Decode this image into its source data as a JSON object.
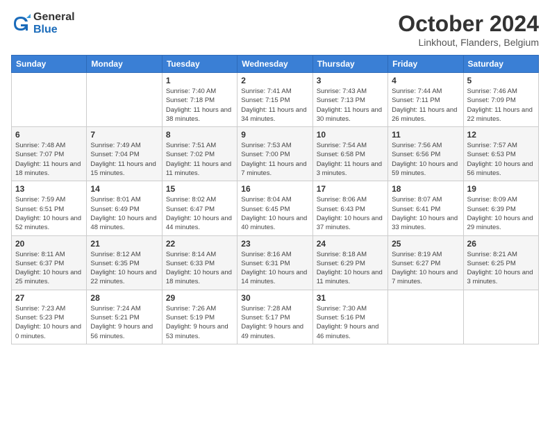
{
  "header": {
    "logo_line1": "General",
    "logo_line2": "Blue",
    "month": "October 2024",
    "location": "Linkhout, Flanders, Belgium"
  },
  "weekdays": [
    "Sunday",
    "Monday",
    "Tuesday",
    "Wednesday",
    "Thursday",
    "Friday",
    "Saturday"
  ],
  "weeks": [
    [
      {
        "day": "",
        "sunrise": "",
        "sunset": "",
        "daylight": ""
      },
      {
        "day": "",
        "sunrise": "",
        "sunset": "",
        "daylight": ""
      },
      {
        "day": "1",
        "sunrise": "Sunrise: 7:40 AM",
        "sunset": "Sunset: 7:18 PM",
        "daylight": "Daylight: 11 hours and 38 minutes."
      },
      {
        "day": "2",
        "sunrise": "Sunrise: 7:41 AM",
        "sunset": "Sunset: 7:15 PM",
        "daylight": "Daylight: 11 hours and 34 minutes."
      },
      {
        "day": "3",
        "sunrise": "Sunrise: 7:43 AM",
        "sunset": "Sunset: 7:13 PM",
        "daylight": "Daylight: 11 hours and 30 minutes."
      },
      {
        "day": "4",
        "sunrise": "Sunrise: 7:44 AM",
        "sunset": "Sunset: 7:11 PM",
        "daylight": "Daylight: 11 hours and 26 minutes."
      },
      {
        "day": "5",
        "sunrise": "Sunrise: 7:46 AM",
        "sunset": "Sunset: 7:09 PM",
        "daylight": "Daylight: 11 hours and 22 minutes."
      }
    ],
    [
      {
        "day": "6",
        "sunrise": "Sunrise: 7:48 AM",
        "sunset": "Sunset: 7:07 PM",
        "daylight": "Daylight: 11 hours and 18 minutes."
      },
      {
        "day": "7",
        "sunrise": "Sunrise: 7:49 AM",
        "sunset": "Sunset: 7:04 PM",
        "daylight": "Daylight: 11 hours and 15 minutes."
      },
      {
        "day": "8",
        "sunrise": "Sunrise: 7:51 AM",
        "sunset": "Sunset: 7:02 PM",
        "daylight": "Daylight: 11 hours and 11 minutes."
      },
      {
        "day": "9",
        "sunrise": "Sunrise: 7:53 AM",
        "sunset": "Sunset: 7:00 PM",
        "daylight": "Daylight: 11 hours and 7 minutes."
      },
      {
        "day": "10",
        "sunrise": "Sunrise: 7:54 AM",
        "sunset": "Sunset: 6:58 PM",
        "daylight": "Daylight: 11 hours and 3 minutes."
      },
      {
        "day": "11",
        "sunrise": "Sunrise: 7:56 AM",
        "sunset": "Sunset: 6:56 PM",
        "daylight": "Daylight: 10 hours and 59 minutes."
      },
      {
        "day": "12",
        "sunrise": "Sunrise: 7:57 AM",
        "sunset": "Sunset: 6:53 PM",
        "daylight": "Daylight: 10 hours and 56 minutes."
      }
    ],
    [
      {
        "day": "13",
        "sunrise": "Sunrise: 7:59 AM",
        "sunset": "Sunset: 6:51 PM",
        "daylight": "Daylight: 10 hours and 52 minutes."
      },
      {
        "day": "14",
        "sunrise": "Sunrise: 8:01 AM",
        "sunset": "Sunset: 6:49 PM",
        "daylight": "Daylight: 10 hours and 48 minutes."
      },
      {
        "day": "15",
        "sunrise": "Sunrise: 8:02 AM",
        "sunset": "Sunset: 6:47 PM",
        "daylight": "Daylight: 10 hours and 44 minutes."
      },
      {
        "day": "16",
        "sunrise": "Sunrise: 8:04 AM",
        "sunset": "Sunset: 6:45 PM",
        "daylight": "Daylight: 10 hours and 40 minutes."
      },
      {
        "day": "17",
        "sunrise": "Sunrise: 8:06 AM",
        "sunset": "Sunset: 6:43 PM",
        "daylight": "Daylight: 10 hours and 37 minutes."
      },
      {
        "day": "18",
        "sunrise": "Sunrise: 8:07 AM",
        "sunset": "Sunset: 6:41 PM",
        "daylight": "Daylight: 10 hours and 33 minutes."
      },
      {
        "day": "19",
        "sunrise": "Sunrise: 8:09 AM",
        "sunset": "Sunset: 6:39 PM",
        "daylight": "Daylight: 10 hours and 29 minutes."
      }
    ],
    [
      {
        "day": "20",
        "sunrise": "Sunrise: 8:11 AM",
        "sunset": "Sunset: 6:37 PM",
        "daylight": "Daylight: 10 hours and 25 minutes."
      },
      {
        "day": "21",
        "sunrise": "Sunrise: 8:12 AM",
        "sunset": "Sunset: 6:35 PM",
        "daylight": "Daylight: 10 hours and 22 minutes."
      },
      {
        "day": "22",
        "sunrise": "Sunrise: 8:14 AM",
        "sunset": "Sunset: 6:33 PM",
        "daylight": "Daylight: 10 hours and 18 minutes."
      },
      {
        "day": "23",
        "sunrise": "Sunrise: 8:16 AM",
        "sunset": "Sunset: 6:31 PM",
        "daylight": "Daylight: 10 hours and 14 minutes."
      },
      {
        "day": "24",
        "sunrise": "Sunrise: 8:18 AM",
        "sunset": "Sunset: 6:29 PM",
        "daylight": "Daylight: 10 hours and 11 minutes."
      },
      {
        "day": "25",
        "sunrise": "Sunrise: 8:19 AM",
        "sunset": "Sunset: 6:27 PM",
        "daylight": "Daylight: 10 hours and 7 minutes."
      },
      {
        "day": "26",
        "sunrise": "Sunrise: 8:21 AM",
        "sunset": "Sunset: 6:25 PM",
        "daylight": "Daylight: 10 hours and 3 minutes."
      }
    ],
    [
      {
        "day": "27",
        "sunrise": "Sunrise: 7:23 AM",
        "sunset": "Sunset: 5:23 PM",
        "daylight": "Daylight: 10 hours and 0 minutes."
      },
      {
        "day": "28",
        "sunrise": "Sunrise: 7:24 AM",
        "sunset": "Sunset: 5:21 PM",
        "daylight": "Daylight: 9 hours and 56 minutes."
      },
      {
        "day": "29",
        "sunrise": "Sunrise: 7:26 AM",
        "sunset": "Sunset: 5:19 PM",
        "daylight": "Daylight: 9 hours and 53 minutes."
      },
      {
        "day": "30",
        "sunrise": "Sunrise: 7:28 AM",
        "sunset": "Sunset: 5:17 PM",
        "daylight": "Daylight: 9 hours and 49 minutes."
      },
      {
        "day": "31",
        "sunrise": "Sunrise: 7:30 AM",
        "sunset": "Sunset: 5:16 PM",
        "daylight": "Daylight: 9 hours and 46 minutes."
      },
      {
        "day": "",
        "sunrise": "",
        "sunset": "",
        "daylight": ""
      },
      {
        "day": "",
        "sunrise": "",
        "sunset": "",
        "daylight": ""
      }
    ]
  ]
}
